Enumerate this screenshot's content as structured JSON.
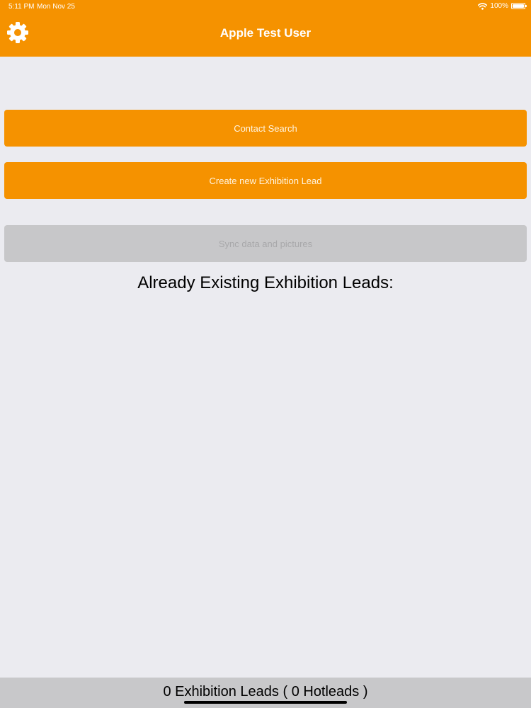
{
  "status_bar": {
    "time": "5:11 PM",
    "date": "Mon Nov 25",
    "battery": "100%",
    "battery_level": 1.0,
    "wifi_icon": "wifi-icon",
    "battery_icon": "battery-icon"
  },
  "nav": {
    "title": "Apple Test User",
    "settings_icon": "gear-icon"
  },
  "buttons": {
    "contact_search": "Contact Search",
    "create_lead": "Create new Exhibition Lead",
    "sync": "Sync data and pictures"
  },
  "leads": {
    "heading": "Already Existing Exhibition Leads:",
    "items": []
  },
  "footer": {
    "summary": "0 Exhibition Leads ( 0 Hotleads )"
  },
  "colors": {
    "accent": "#f59200",
    "background": "#ebebf0",
    "disabled_button": "#c7c7c9",
    "footer_bar": "#c8c8ca"
  }
}
